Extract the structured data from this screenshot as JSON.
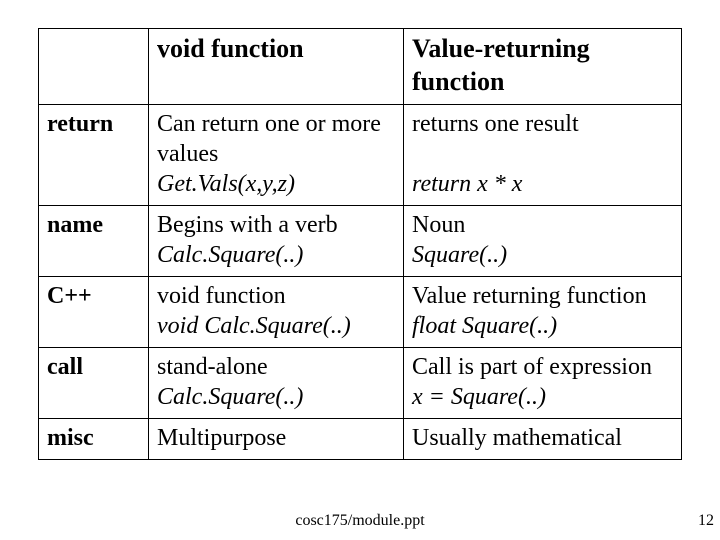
{
  "table": {
    "headers": {
      "void": "void function",
      "value": "Value-returning function"
    },
    "rows": {
      "return": {
        "label": "return",
        "void_line1": "Can return one or more values",
        "void_line2": "Get.Vals(x,y,z)",
        "value_line1": "returns one result",
        "value_line2": "return x * x"
      },
      "name": {
        "label": "name",
        "void_line1": "Begins with a verb",
        "void_line2": "Calc.Square(..)",
        "value_line1": "Noun",
        "value_line2": "Square(..)"
      },
      "cpp": {
        "label": "C++",
        "void_line1": "void function",
        "void_line2": "void Calc.Square(..)",
        "value_line1": "Value returning function",
        "value_line2": "float Square(..)"
      },
      "call": {
        "label": "call",
        "void_line1": "stand-alone",
        "void_line2": "Calc.Square(..)",
        "value_line1": "Call is part of expression",
        "value_line2": "x = Square(..)"
      },
      "misc": {
        "label": "misc",
        "void_line1": "Multipurpose",
        "value_line1": "Usually mathematical"
      }
    }
  },
  "footer": {
    "path": "cosc175/module.ppt",
    "page": "12"
  },
  "chart_data": {
    "type": "table",
    "title": "",
    "columns": [
      "",
      "void function",
      "Value-returning function"
    ],
    "rows": [
      [
        "return",
        "Can return one or more values / Get.Vals(x,y,z)",
        "returns one result / return x * x"
      ],
      [
        "name",
        "Begins with a verb / Calc.Square(..)",
        "Noun / Square(..)"
      ],
      [
        "C++",
        "void function / void Calc.Square(..)",
        "Value returning function / float Square(..)"
      ],
      [
        "call",
        "stand-alone / Calc.Square(..)",
        "Call is part of expression / x = Square(..)"
      ],
      [
        "misc",
        "Multipurpose",
        "Usually mathematical"
      ]
    ]
  }
}
